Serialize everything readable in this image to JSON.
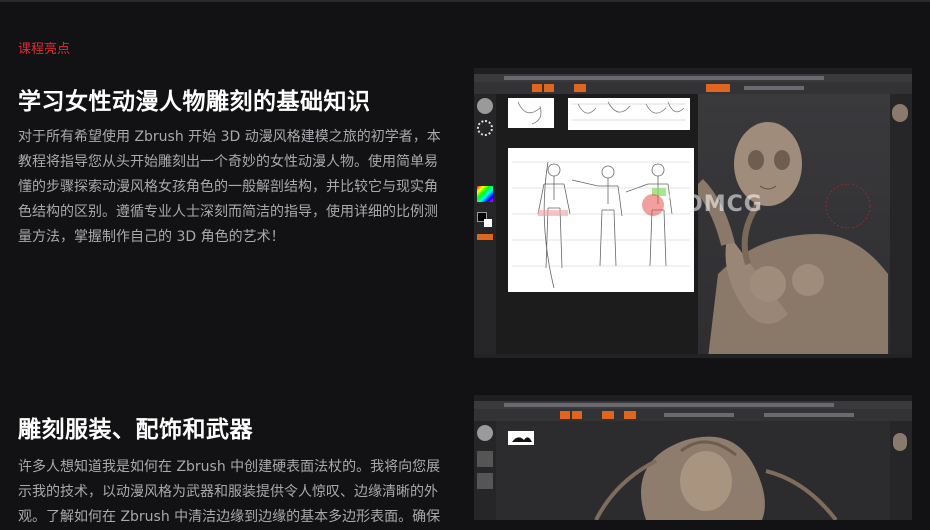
{
  "section_tag": "课程亮点",
  "section1": {
    "title": "学习女性动漫人物雕刻的基础知识",
    "lines": [
      "对于所有希望使用 Zbrush 开始 3D 动漫风格建模之旅的初学者，本",
      "教程将指导您从头开始雕刻出一个奇妙的女性动漫人物。使用简单易",
      "懂的步骤探索动漫风格女孩角色的一般解剖结构，并比较它与现实角",
      "色结构的区别。遵循专业人士深刻而简洁的指导，使用详细的比例测",
      "量方法，掌握制作自己的 3D 角色的艺术！"
    ]
  },
  "section2": {
    "title": "雕刻服装、配饰和武器",
    "lines": [
      "许多人想知道我是如何在 Zbrush 中创建硬表面法杖的。我将向您展",
      "示我的技术，以动漫风格为武器和服装提供令人惊叹、边缘清晰的外",
      "观。了解如何在 Zbrush 中清洁边缘到边缘的基本多边形表面。确保"
    ]
  },
  "screenshot1": {
    "watermark": "TOMCG"
  },
  "colors": {
    "accent": "#e02a33",
    "zbrush_orange": "#e0651e",
    "background": "#121214"
  }
}
